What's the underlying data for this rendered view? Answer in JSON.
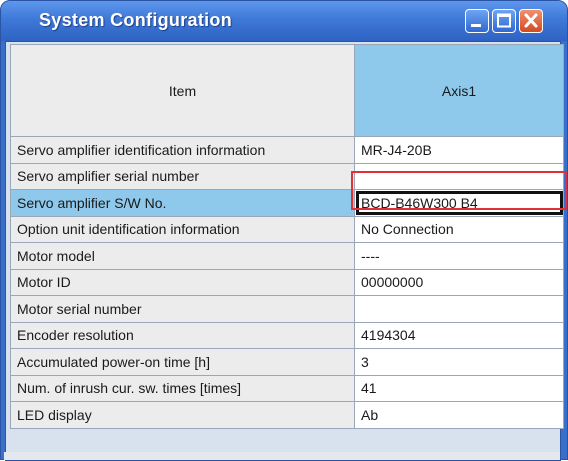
{
  "window": {
    "title": "System Configuration",
    "titlebar_color": "#3f79d8",
    "close_color": "#d34a22"
  },
  "table": {
    "headers": {
      "item": "Item",
      "axis": "Axis1"
    },
    "header_axis_color": "#8ec9ec",
    "selected_row_index": 2,
    "rows": [
      {
        "item": "Servo amplifier identification information",
        "value": "MR-J4-20B"
      },
      {
        "item": "Servo amplifier serial number",
        "value": ""
      },
      {
        "item": "Servo amplifier S/W No.",
        "value": "BCD-B46W300 B4"
      },
      {
        "item": "Option unit identification information",
        "value": "No Connection"
      },
      {
        "item": "Motor model",
        "value": "----"
      },
      {
        "item": "Motor ID",
        "value": "00000000"
      },
      {
        "item": "Motor serial number",
        "value": ""
      },
      {
        "item": "Encoder resolution",
        "value": "4194304"
      },
      {
        "item": "Accumulated power-on time [h]",
        "value": "3"
      },
      {
        "item": "Num. of inrush cur. sw. times [times]",
        "value": "41"
      },
      {
        "item": "LED display",
        "value": "Ab"
      }
    ]
  },
  "annotation": {
    "highlight_color": "#e0303a"
  }
}
